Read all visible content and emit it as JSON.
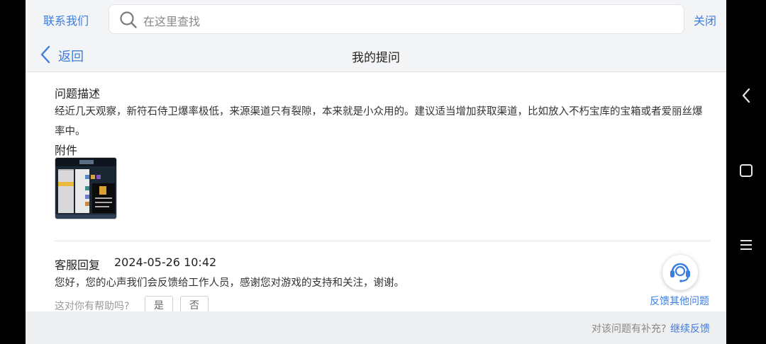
{
  "topbar": {
    "contact_label": "联系我们",
    "search_placeholder": "在这里查找",
    "close_label": "关闭"
  },
  "header": {
    "back_label": "返回",
    "title": "我的提问"
  },
  "question": {
    "section_title": "问题描述",
    "description": "经近几天观察，新符石侍卫爆率极低，来源渠道只有裂隙，本来就是小众用的。建议适当增加获取渠道，比如放入不朽宝库的宝箱或者爱丽丝爆率中。",
    "attachments_title": "附件"
  },
  "reply": {
    "label": "客服回复",
    "time": "2024-05-26 10:42",
    "text": "您好，您的心声我们会反馈给工作人员，感谢您对游戏的支持和关注，谢谢。",
    "helpful_question": "这对你有帮助吗?",
    "yes_label": "是",
    "no_label": "否"
  },
  "fab": {
    "icon": "headset-icon",
    "label": "反馈其他问题"
  },
  "footer": {
    "question": "对该问题有补充?",
    "link_label": "继续反馈"
  },
  "system_nav": {
    "back_icon": "chevron-left-icon",
    "home_icon": "square-icon",
    "menu_icon": "menu-icon"
  },
  "colors": {
    "accent": "#3b7de0",
    "bar_bg": "#f3f4f6",
    "footer_bg": "#eeeff1"
  }
}
